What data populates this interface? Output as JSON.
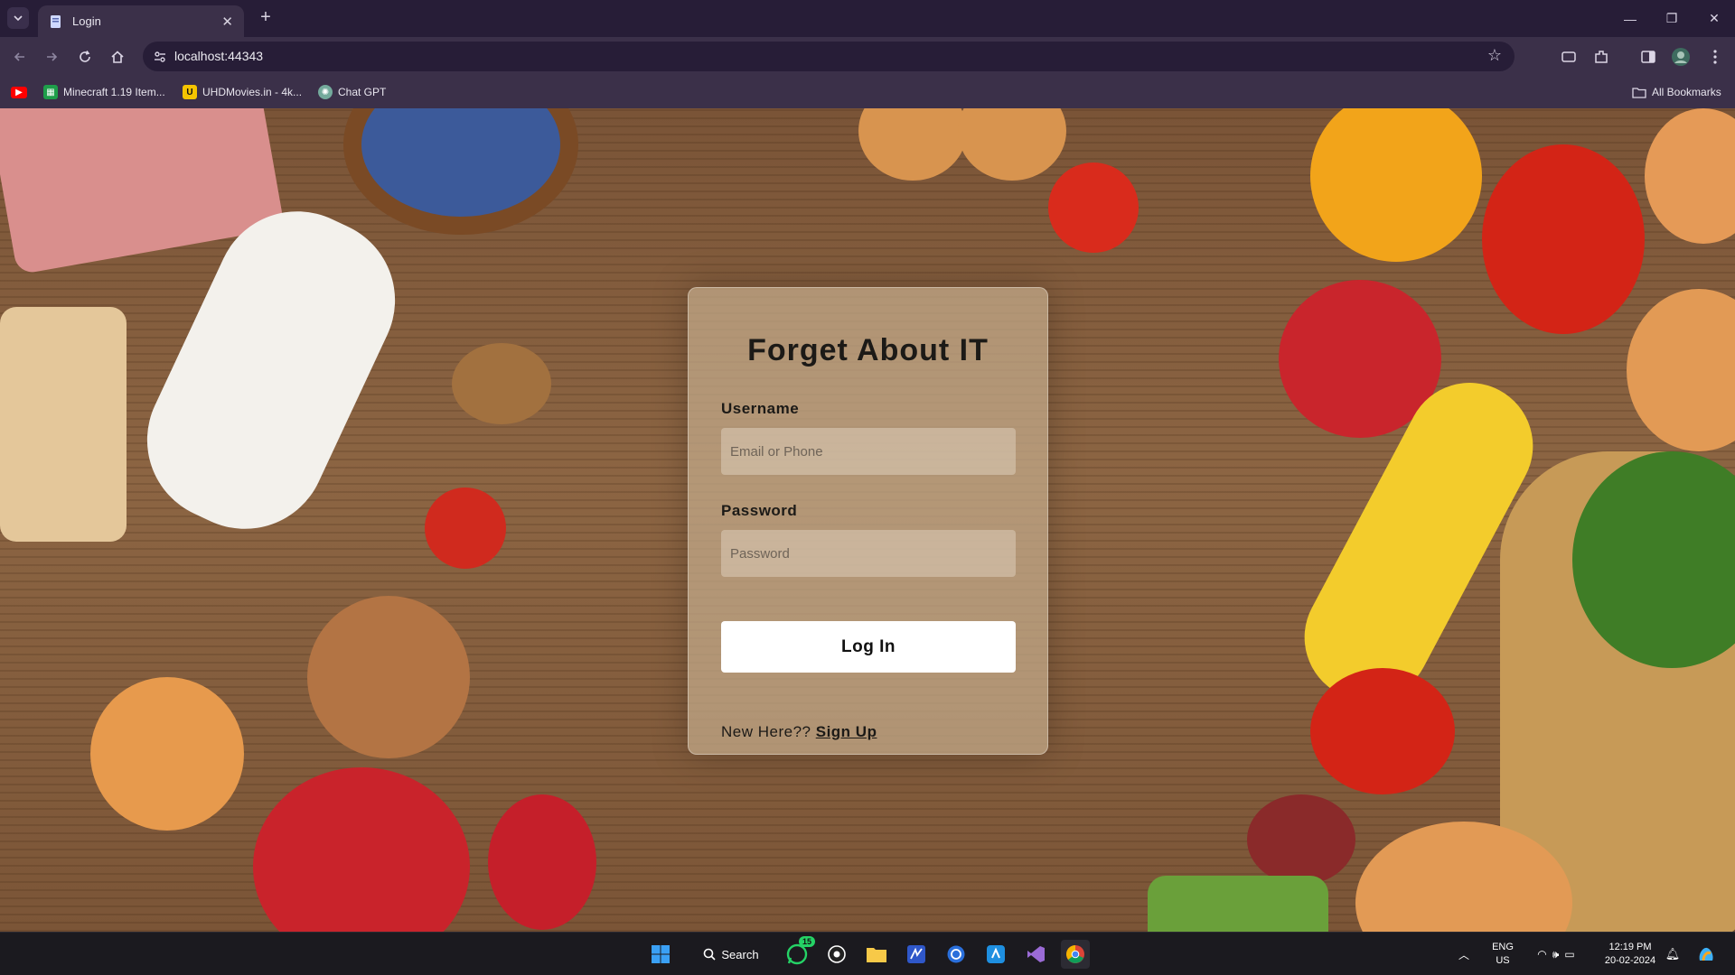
{
  "browser": {
    "tab_title": "Login",
    "url": "localhost:44343",
    "bookmarks": [
      {
        "label": "",
        "icon": "youtube-icon"
      },
      {
        "label": "Minecraft 1.19 Item...",
        "icon": "sheets-icon"
      },
      {
        "label": "UHDMovies.in - 4k...",
        "icon": "uhd-icon"
      },
      {
        "label": "Chat GPT",
        "icon": "chatgpt-icon"
      }
    ],
    "all_bookmarks_label": "All Bookmarks"
  },
  "login": {
    "title": "Forget About IT",
    "username_label": "Username",
    "username_placeholder": "Email or Phone",
    "password_label": "Password",
    "password_placeholder": "Password",
    "login_button": "Log In",
    "signup_prompt": "New Here??",
    "signup_link": "Sign Up"
  },
  "taskbar": {
    "search_label": "Search",
    "whatsapp_badge": "15",
    "language": "ENG",
    "region": "US",
    "time": "12:19 PM",
    "date": "20-02-2024"
  },
  "colors": {
    "titlebar": "#271d37",
    "toolbar": "#3b3049",
    "card": "#c4aa8a",
    "button": "#ffffff"
  }
}
